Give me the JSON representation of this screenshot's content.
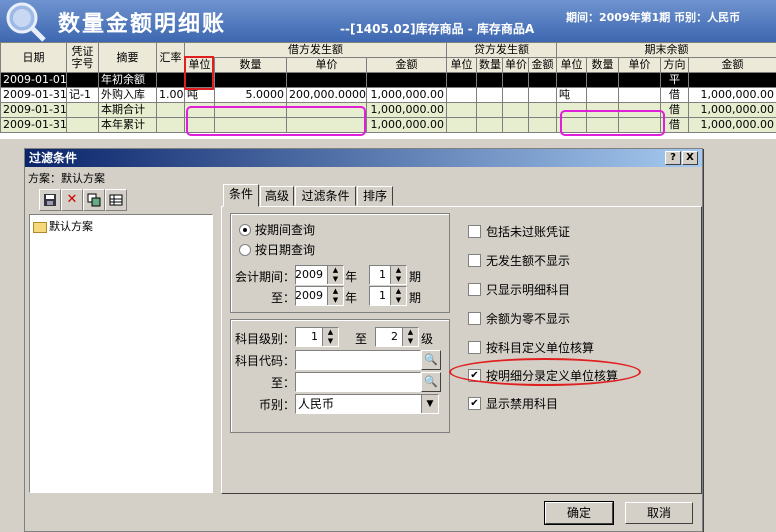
{
  "app": {
    "title": "数量金额明细账",
    "subtitle": "--[1405.02]库存商品 - 库存商品A",
    "period": "期间：2009年第1期 币别：人民币"
  },
  "ledger": {
    "headers": {
      "date": "日期",
      "voucher": "凭证字号",
      "summary": "摘要",
      "rate": "汇率",
      "debit": "借方发生额",
      "credit": "贷方发生额",
      "ending": "期末余额",
      "unit": "单位",
      "qty": "数量",
      "price": "单价",
      "amount": "金额",
      "direction": "方向"
    },
    "rows": [
      {
        "date": "2009-01-01",
        "voucher": "",
        "summary": "年初余额",
        "rate": "",
        "d_unit": "",
        "d_qty": "",
        "d_price": "",
        "d_amount": "",
        "e_unit": "",
        "dir": "平",
        "e_amount": ""
      },
      {
        "date": "2009-01-31",
        "voucher": "记-1",
        "summary": "外购入库",
        "rate": "1.00",
        "d_unit": "吨",
        "d_qty": "5.0000",
        "d_price": "200,000.0000",
        "d_amount": "1,000,000.00",
        "e_unit": "吨",
        "dir": "借",
        "e_amount": "1,000,000.00"
      },
      {
        "date": "2009-01-31",
        "voucher": "",
        "summary": "本期合计",
        "rate": "",
        "d_unit": "",
        "d_qty": "",
        "d_price": "",
        "d_amount": "1,000,000.00",
        "e_unit": "",
        "dir": "借",
        "e_amount": "1,000,000.00"
      },
      {
        "date": "2009-01-31",
        "voucher": "",
        "summary": "本年累计",
        "rate": "",
        "d_unit": "",
        "d_qty": "",
        "d_price": "",
        "d_amount": "1,000,000.00",
        "e_unit": "",
        "dir": "借",
        "e_amount": "1,000,000.00"
      }
    ]
  },
  "dialog": {
    "title": "过滤条件",
    "scheme_label": "方案：默认方案",
    "tree_item": "默认方案",
    "tabs": [
      "条件",
      "高级",
      "过滤条件",
      "排序"
    ],
    "query_by_period": "按期间查询",
    "query_by_date": "按日期查询",
    "period_label": "会计期间：",
    "to_label": "至：",
    "year_from": "2009",
    "period_from": "1",
    "year_to": "2009",
    "period_to": "1",
    "year_unit": "年",
    "period_unit": "期",
    "level_label": "科目级别：",
    "level_from": "1",
    "level_to_label": "至",
    "level_to": "2",
    "level_unit": "级",
    "code_label": "科目代码：",
    "code_to_label": "至：",
    "currency_label": "币别：",
    "currency_value": "人民币",
    "checks": [
      {
        "label": "包括未过账凭证",
        "checked": false
      },
      {
        "label": "无发生额不显示",
        "checked": false
      },
      {
        "label": "只显示明细科目",
        "checked": false
      },
      {
        "label": "余额为零不显示",
        "checked": false
      },
      {
        "label": "按科目定义单位核算",
        "checked": false
      },
      {
        "label": "按明细分录定义单位核算",
        "checked": true
      },
      {
        "label": "显示禁用科目",
        "checked": true
      }
    ],
    "ok": "确定",
    "cancel": "取消",
    "help": "?",
    "close": "X"
  }
}
